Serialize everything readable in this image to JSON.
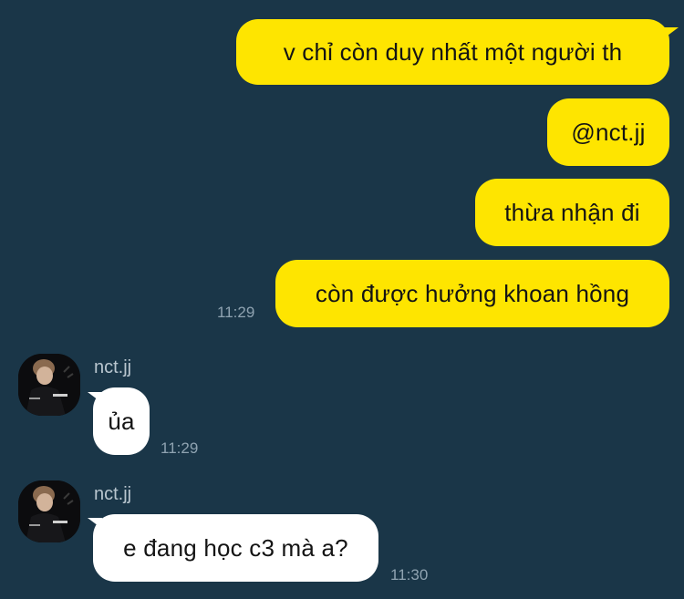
{
  "outgoing": [
    {
      "text": "v chỉ còn duy nhất một người th"
    },
    {
      "text": "@nct.jj"
    },
    {
      "text": "thừa nhận đi"
    },
    {
      "text": "còn được hưởng khoan hồng",
      "time": "11:29"
    }
  ],
  "incoming": [
    {
      "sender": "nct.jj",
      "text": "ủa",
      "time": "11:29",
      "avatar": "user-avatar-photo"
    },
    {
      "sender": "nct.jj",
      "text": "e đang học c3 mà a?",
      "time": "11:30",
      "avatar": "user-avatar-photo"
    }
  ],
  "colors": {
    "background": "#1a3648",
    "outgoing_bubble": "#fee500",
    "incoming_bubble": "#ffffff",
    "timestamp": "#8fa3b1",
    "sender_name": "#b9c6cf"
  }
}
